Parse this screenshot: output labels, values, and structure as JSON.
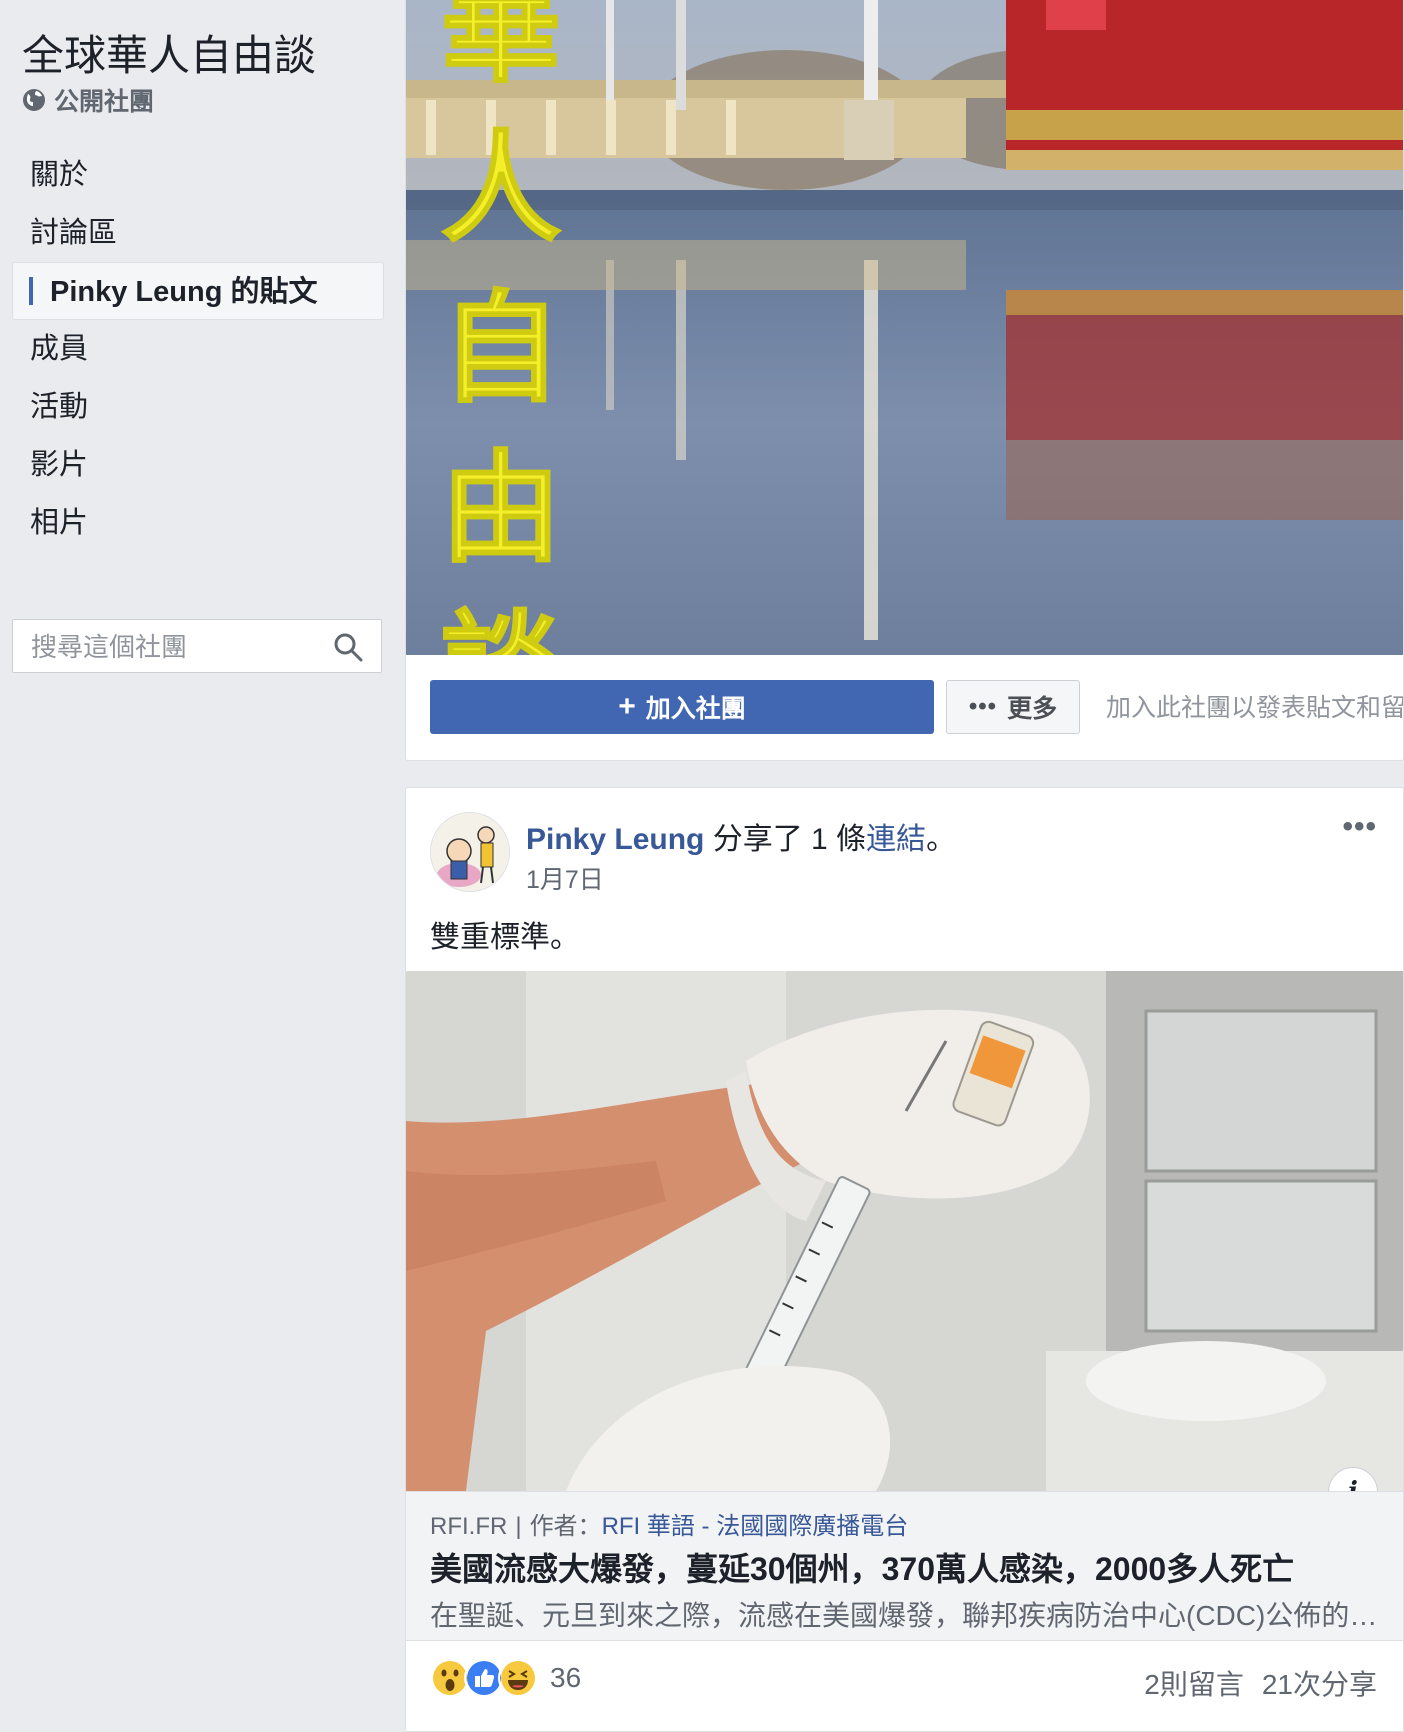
{
  "group": {
    "title": "全球華人自由談",
    "privacy": "公開社團"
  },
  "nav": {
    "items": [
      {
        "label": "關於"
      },
      {
        "label": "討論區"
      },
      {
        "label": "Pinky Leung 的貼文",
        "active": true
      },
      {
        "label": "成員"
      },
      {
        "label": "活動"
      },
      {
        "label": "影片"
      },
      {
        "label": "相片"
      }
    ]
  },
  "search": {
    "placeholder": "搜尋這個社團"
  },
  "cover": {
    "image_text": [
      "華",
      "人",
      "自",
      "由",
      "談"
    ],
    "join_label": "加入社團",
    "more_label": "更多",
    "hint": "加入此社團以發表貼文和留言"
  },
  "post": {
    "author": "Pinky Leung",
    "action": " 分享了 1 條",
    "link_word": "連結",
    "end": "。",
    "date": "1月7日",
    "text": "雙重標準。",
    "link": {
      "domain": "RFI.FR",
      "separator": "|",
      "author_prefix": "作者：",
      "author": "RFI 華語 - 法國國際廣播電台",
      "title": "美國流感大爆發，蔓延30個州，370萬人感染，2000多人死亡",
      "description": "在聖誕、元旦到來之際，流感在美國爆發，聯邦疾病防治中心(CDC)公佈的數據顯示"
    },
    "reaction_count": "36",
    "comments": "2則留言",
    "shares": "21次分享"
  },
  "colors": {
    "accent": "#4267b2",
    "link": "#385898",
    "background": "#e9ebee"
  },
  "icons": {
    "privacy": "globe-icon",
    "search": "search-icon",
    "join": "plus-icon",
    "more": "more-dots-icon",
    "info": "info-icon",
    "reactions": [
      "wow-icon",
      "like-icon",
      "haha-icon"
    ]
  }
}
